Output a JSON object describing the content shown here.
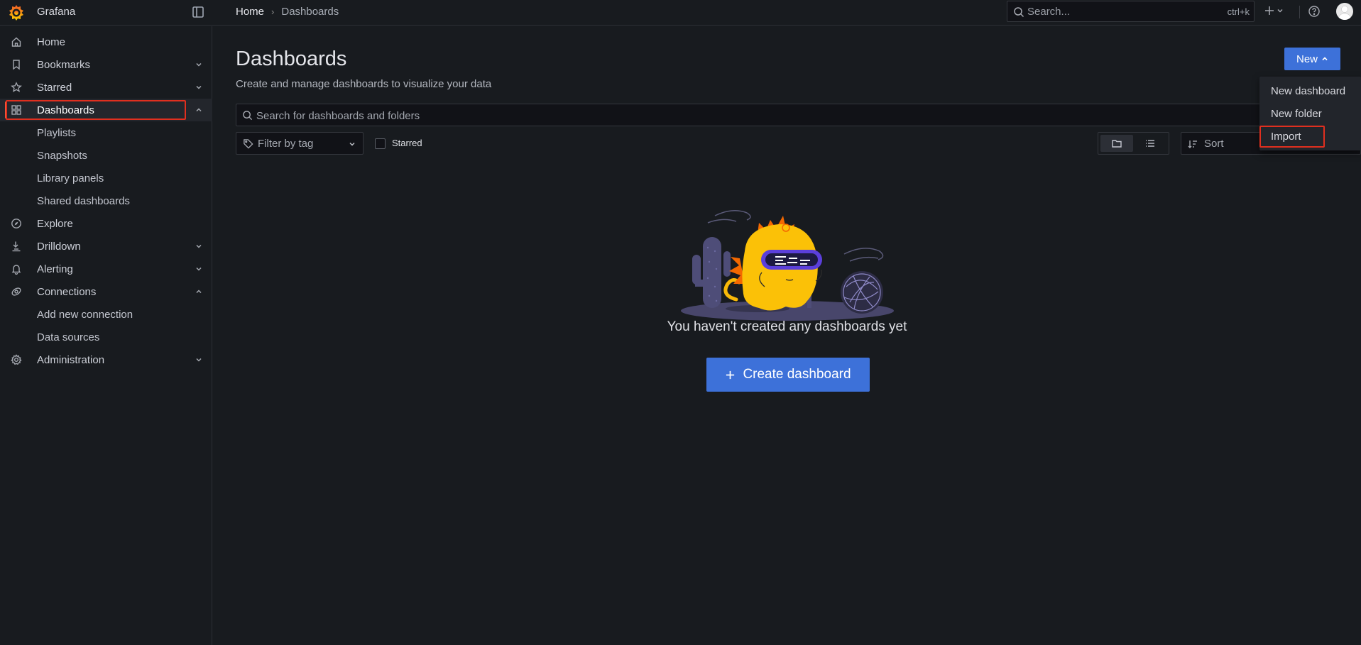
{
  "app": {
    "name": "Grafana"
  },
  "colors": {
    "accent": "#3d71d9",
    "active_bar": "#f55f3e",
    "highlight": "#e02f1f",
    "background": "#181b1f"
  },
  "breadcrumb": {
    "home": "Home",
    "separator": "›",
    "current": "Dashboards"
  },
  "global_search": {
    "placeholder": "Search...",
    "shortcut": "ctrl+k"
  },
  "sidebar": {
    "items": [
      {
        "label": "Home",
        "icon": "home-icon"
      },
      {
        "label": "Bookmarks",
        "icon": "bookmark-icon"
      },
      {
        "label": "Starred",
        "icon": "star-icon"
      },
      {
        "label": "Dashboards",
        "icon": "apps-icon",
        "active": true
      },
      {
        "label": "Playlists"
      },
      {
        "label": "Snapshots"
      },
      {
        "label": "Library panels"
      },
      {
        "label": "Shared dashboards"
      },
      {
        "label": "Explore",
        "icon": "compass-icon"
      },
      {
        "label": "Drilldown",
        "icon": "drilldown-icon"
      },
      {
        "label": "Alerting",
        "icon": "bell-icon"
      },
      {
        "label": "Connections",
        "icon": "plug-icon"
      },
      {
        "label": "Add new connection"
      },
      {
        "label": "Data sources"
      },
      {
        "label": "Administration",
        "icon": "gear-icon"
      }
    ]
  },
  "main": {
    "title": "Dashboards",
    "subtitle": "Create and manage dashboards to visualize your data",
    "new_button": "New",
    "search_placeholder": "Search for dashboards and folders",
    "tag_filter": "Filter by tag",
    "starred_label": "Starred",
    "sort_label": "Sort",
    "empty_message": "You haven't created any dashboards yet",
    "create_button": "Create dashboard"
  },
  "new_menu": {
    "items": [
      "New dashboard",
      "New folder",
      "Import"
    ]
  }
}
